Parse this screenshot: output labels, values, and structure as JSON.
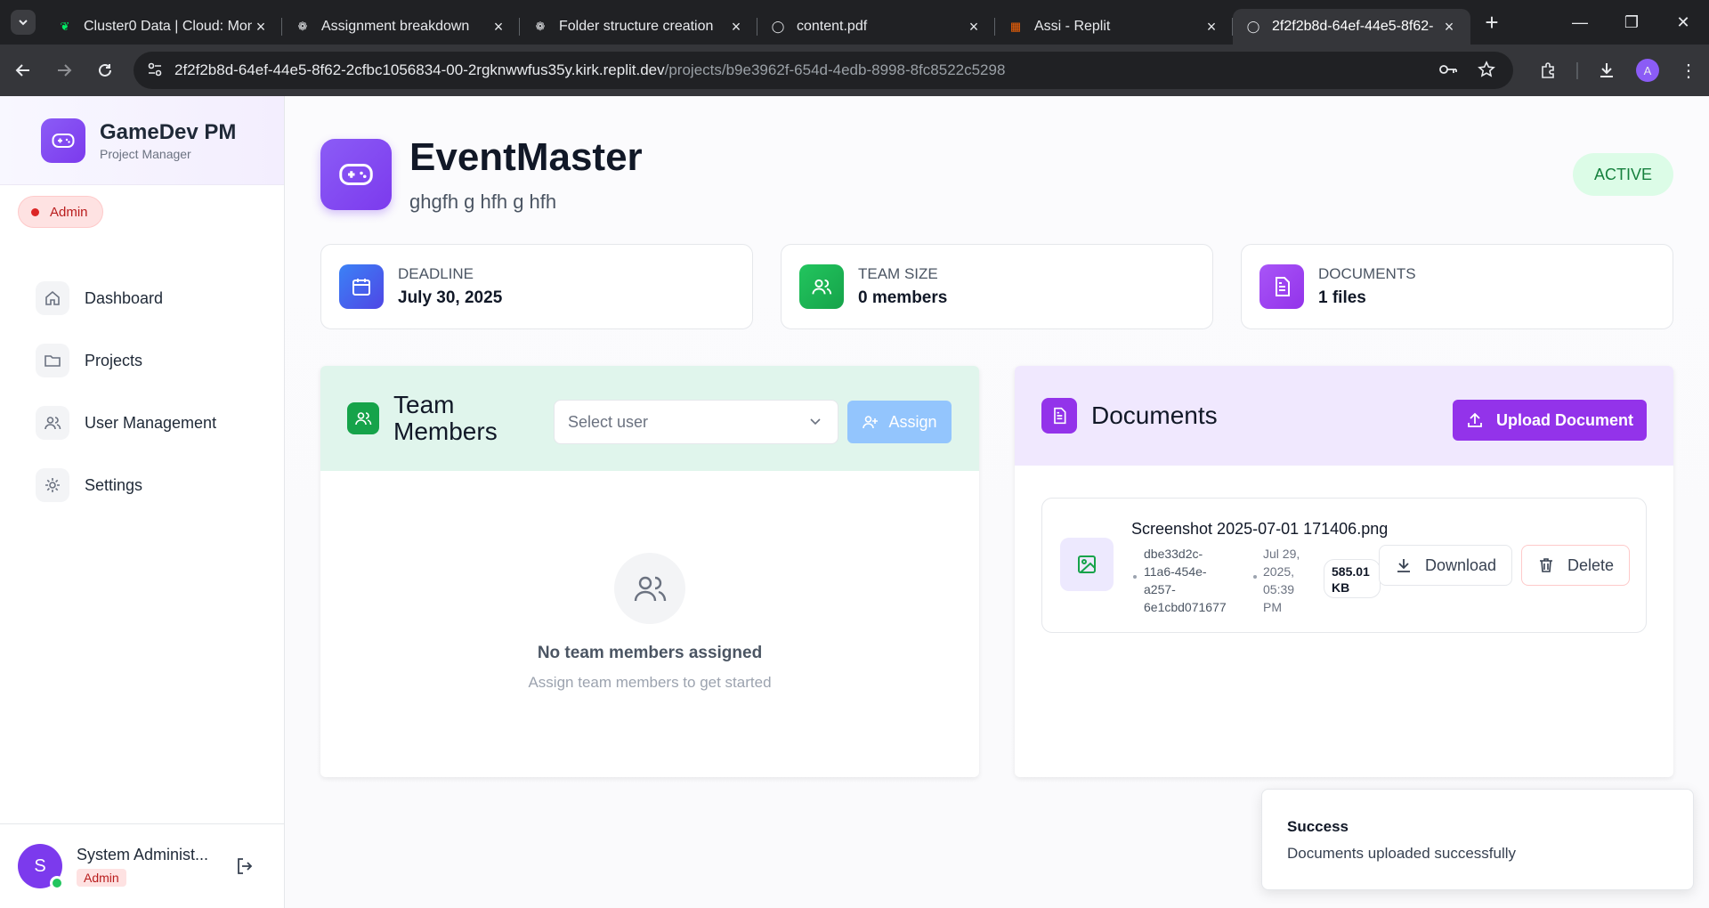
{
  "browser": {
    "tabs": [
      {
        "title": "Cluster0 Data | Cloud: Mon",
        "favicon": "mongodb-leaf-icon",
        "color": "#00ed64"
      },
      {
        "title": "Assignment breakdown",
        "favicon": "openai-icon",
        "color": "#e8eaed"
      },
      {
        "title": "Folder structure creation",
        "favicon": "openai-icon",
        "color": "#e8eaed"
      },
      {
        "title": "content.pdf",
        "favicon": "globe-icon",
        "color": "#e8eaed"
      },
      {
        "title": "Assi - Replit",
        "favicon": "replit-icon",
        "color": "#f26207"
      },
      {
        "title": "2f2f2b8d-64ef-44e5-8f62-",
        "favicon": "globe-icon",
        "color": "#e8eaed",
        "active": true
      }
    ],
    "url_host": "2f2f2b8d-64ef-44e5-8f62-2cfbc1056834-00-2rgknwwfus35y.kirk.replit.dev",
    "url_path": "/projects/b9e3962f-654d-4edb-8998-8fc8522c5298",
    "profile_initial": "A"
  },
  "sidebar": {
    "brand_title": "GameDev PM",
    "brand_subtitle": "Project Manager",
    "role_badge": "Admin",
    "nav": [
      {
        "label": "Dashboard",
        "icon": "home-icon"
      },
      {
        "label": "Projects",
        "icon": "folder-icon"
      },
      {
        "label": "User Management",
        "icon": "users-icon"
      },
      {
        "label": "Settings",
        "icon": "gear-icon"
      }
    ],
    "user": {
      "initial": "S",
      "name": "System Administ...",
      "role": "Admin"
    }
  },
  "project": {
    "title": "EventMaster",
    "description": "ghgfh g hfh g hfh",
    "status": "ACTIVE"
  },
  "stats": [
    {
      "label": "Deadline",
      "value": "July 30, 2025",
      "icon": "calendar-icon",
      "color": "#4f46e5"
    },
    {
      "label": "Team Size",
      "value": "0 members",
      "icon": "users-icon",
      "color": "#16a34a"
    },
    {
      "label": "Documents",
      "value": "1 files",
      "icon": "file-text-icon",
      "color": "#9333ea"
    }
  ],
  "team": {
    "title_line1": "Team",
    "title_line2": "Members",
    "select_placeholder": "Select user",
    "assign_label": "Assign",
    "empty_title": "No team members assigned",
    "empty_subtitle": "Assign team members to get started"
  },
  "documents": {
    "title": "Documents",
    "upload_label": "Upload Document",
    "items": [
      {
        "name": "Screenshot 2025-07-01 171406.png",
        "id_lines": [
          "dbe33d2c-",
          "11a6-454e-",
          "a257-",
          "6e1cbd071677"
        ],
        "date_lines": [
          "Jul 29,",
          "2025,",
          "05:39",
          "PM"
        ],
        "size_lines": [
          "585.01",
          "KB"
        ],
        "download_label": "Download",
        "delete_label": "Delete"
      }
    ]
  },
  "toast": {
    "title": "Success",
    "message": "Documents uploaded successfully"
  }
}
